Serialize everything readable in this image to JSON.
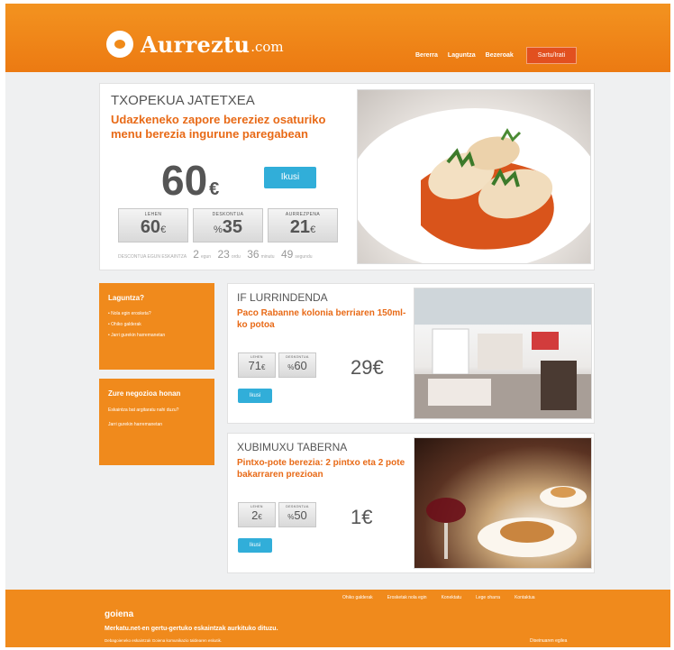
{
  "header": {
    "logo_text": "Aurreztu",
    "logo_suffix": ".com",
    "nav": [
      "Bererra",
      "Laguntza",
      "Bezeroak"
    ],
    "login_label": "Sartu/Irati"
  },
  "main_deal": {
    "vendor": "TXOPEKUA JATETXEA",
    "title": "Udazkeneko zapore bereziez osaturiko menu berezia ingurune paregabean",
    "price": "60",
    "currency": "€",
    "buy_label": "Ikusi",
    "stats": [
      {
        "label": "LEHEN",
        "value": "60",
        "unit": "€"
      },
      {
        "label": "DESKONTUA",
        "value": "35",
        "prefix": "%"
      },
      {
        "label": "AURREZPENA",
        "value": "21",
        "unit": "€"
      }
    ],
    "countdown_label": "DESCONTUA EGUN ESKAINTZA",
    "countdown": [
      {
        "num": "2",
        "unit": "egun"
      },
      {
        "num": "23",
        "unit": "ordu"
      },
      {
        "num": "36",
        "unit": "minutu"
      },
      {
        "num": "49",
        "unit": "segundu"
      }
    ]
  },
  "sidebar": {
    "help_title": "Laguntza?",
    "help_items": [
      "Nola egin erosketa?",
      "Ohiko galderak",
      "Jarri gurekin harremanetan"
    ],
    "biz_title": "Zure negozioa honan",
    "biz_text": "Eskaintza bat argitaratu nahi duzu?",
    "biz_link": "Jarri gurekin harremanetan"
  },
  "deals": [
    {
      "vendor": "IF LURRINDENDA",
      "title": "Paco Rabanne kolonia berriaren 150ml-ko potoa",
      "stats": [
        {
          "label": "LEHEN",
          "value": "71",
          "unit": "€"
        },
        {
          "label": "DESKONTUA",
          "value": "60",
          "prefix": "%"
        }
      ],
      "price": "29",
      "currency": "€",
      "buy_label": "Ikusi"
    },
    {
      "vendor": "XUBIMUXU TABERNA",
      "title": "Pintxo-pote berezia: 2 pintxo eta 2 pote bakarraren prezioan",
      "stats": [
        {
          "label": "LEHEN",
          "value": "2",
          "unit": "€"
        },
        {
          "label": "DESKONTUA",
          "value": "50",
          "prefix": "%"
        }
      ],
      "price": "1",
      "currency": "€",
      "buy_label": "Ikusi"
    }
  ],
  "footer": {
    "nav": [
      "Ohiko galderak",
      "Erosketak nola egin",
      "Konektatu",
      "Lege oharra",
      "Kontaktua"
    ],
    "logo": "goiena",
    "tagline": "Merkatu.net-en gertu-gertuko eskaintzak aurkituko dituzu.",
    "sub": "Debagoieneko eskaintzak Goiena komunikazio taldearen eskutik.",
    "credit": "Diseinuaren egilea"
  }
}
